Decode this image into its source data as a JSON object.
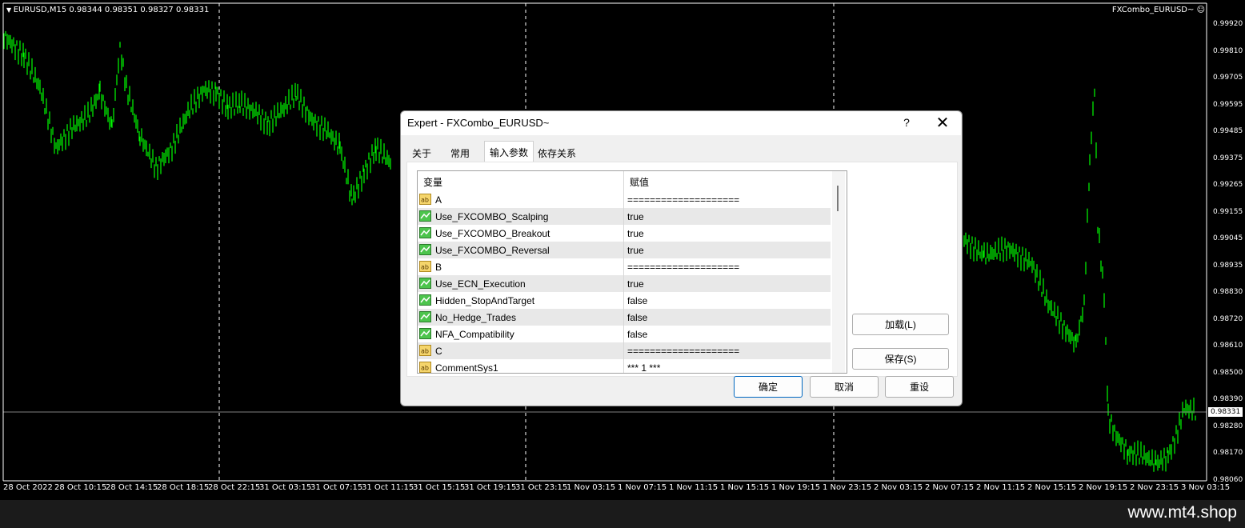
{
  "chart": {
    "symbol_info": "EURUSD,M15  0.98344 0.98351 0.98327 0.98331",
    "expert_label": "FXCombo_EURUSD~ ☺",
    "current_price": "0.98331",
    "price_ticks": [
      "0.99920",
      "0.99810",
      "0.99705",
      "0.99595",
      "0.99485",
      "0.99375",
      "0.99265",
      "0.99155",
      "0.99045",
      "0.98935",
      "0.98830",
      "0.98720",
      "0.98610",
      "0.98500",
      "0.98390",
      "0.98280",
      "0.98170",
      "0.98060"
    ],
    "time_ticks": [
      "28 Oct 2022",
      "28 Oct 10:15",
      "28 Oct 14:15",
      "28 Oct 18:15",
      "28 Oct 22:15",
      "31 Oct 03:15",
      "31 Oct 07:15",
      "31 Oct 11:15",
      "31 Oct 15:15",
      "31 Oct 19:15",
      "31 Oct 23:15",
      "1 Nov 03:15",
      "1 Nov 07:15",
      "1 Nov 11:15",
      "1 Nov 15:15",
      "1 Nov 19:15",
      "1 Nov 23:15",
      "2 Nov 03:15",
      "2 Nov 07:15",
      "2 Nov 11:15",
      "2 Nov 15:15",
      "2 Nov 19:15",
      "2 Nov 23:15",
      "3 Nov 03:15"
    ],
    "colors": {
      "background": "#000000",
      "candles": "#00ff00",
      "text": "#ffffff",
      "grid": "#ffffff"
    }
  },
  "footer": {
    "watermark": "www.mt4.shop"
  },
  "dialog": {
    "title": "Expert - FXCombo_EURUSD~",
    "help": "?",
    "close": "✕",
    "tabs": [
      {
        "label": "关于",
        "active": false
      },
      {
        "label": "常用",
        "active": false
      },
      {
        "label": "输入参数",
        "active": true
      },
      {
        "label": "依存关系",
        "active": false
      }
    ],
    "table": {
      "headers": [
        "变量",
        "赋值"
      ],
      "rows": [
        {
          "icon": "text-param-icon",
          "name": "A",
          "value": "===================="
        },
        {
          "icon": "bool-param-icon",
          "name": "Use_FXCOMBO_Scalping",
          "value": "true"
        },
        {
          "icon": "bool-param-icon",
          "name": "Use_FXCOMBO_Breakout",
          "value": "true"
        },
        {
          "icon": "bool-param-icon",
          "name": "Use_FXCOMBO_Reversal",
          "value": "true"
        },
        {
          "icon": "text-param-icon",
          "name": "B",
          "value": "===================="
        },
        {
          "icon": "bool-param-icon",
          "name": "Use_ECN_Execution",
          "value": "true"
        },
        {
          "icon": "bool-param-icon",
          "name": "Hidden_StopAndTarget",
          "value": "false"
        },
        {
          "icon": "bool-param-icon",
          "name": "No_Hedge_Trades",
          "value": "false"
        },
        {
          "icon": "bool-param-icon",
          "name": "NFA_Compatibility",
          "value": "false"
        },
        {
          "icon": "text-param-icon",
          "name": "C",
          "value": "===================="
        },
        {
          "icon": "text-param-icon",
          "name": "CommentSys1",
          "value": "*** 1 ***"
        }
      ]
    },
    "buttons": {
      "load": "加载(L)",
      "save": "保存(S)",
      "ok": "确定",
      "cancel": "取消",
      "reset": "重设"
    }
  }
}
